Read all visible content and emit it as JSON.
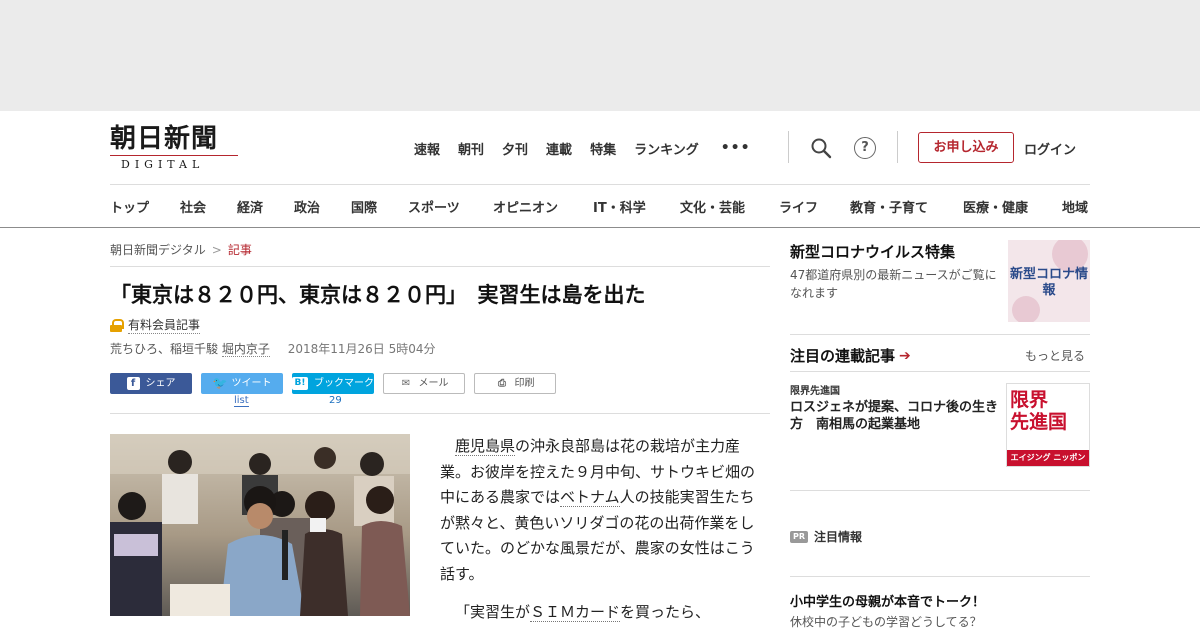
{
  "header": {
    "logo_main": "朝日新聞",
    "logo_sub": "DIGITAL",
    "top_nav": [
      "速報",
      "朝刊",
      "夕刊",
      "連載",
      "特集",
      "ランキング"
    ],
    "more_icon": "•••",
    "help_icon": "?",
    "subscribe": "お申し込み",
    "login": "ログイン",
    "accent_color": "#b5262e"
  },
  "category_nav": [
    "トップ",
    "社会",
    "経済",
    "政治",
    "国際",
    "スポーツ",
    "オピニオン",
    "IT・科学",
    "文化・芸能",
    "ライフ",
    "教育・子育て",
    "医療・健康",
    "地域"
  ],
  "breadcrumb": {
    "home": "朝日新聞デジタル",
    "sep": ">",
    "current": "記事"
  },
  "article": {
    "headline": "「東京は８２０円、東京は８２０円」　実習生は島を出た",
    "member_label": "有料会員記事",
    "authors": "荒ちひろ、稲垣千駿",
    "author_linked": "堀内京子",
    "date": "2018年11月26日 5時04分",
    "share": {
      "facebook": "シェア",
      "twitter": "ツイート",
      "twitter_count": "list",
      "hatena": "ブックマーク",
      "hatena_count": "29",
      "mail": "メール",
      "print": "印刷"
    },
    "para1_link1": "鹿児島県",
    "para1_a": "の沖永良部島は花の栽培が主力産業。お彼岸を控えた９月中旬、サトウキビ畑の中にある農家では",
    "para1_link2": "ベトナム",
    "para1_b": "人の技能実習生たちが黙々と、黄色いソリダゴの花の出荷作業をしていた。のどかな風景だが、農家の女性はこう話す。",
    "para2_a": "「実習生が",
    "para2_link": "ＳＩＭカード",
    "para2_b": "を買ったら、"
  },
  "sidebar": {
    "corona_title": "新型コロナウイルス特集",
    "corona_desc": "47都道府県別の最新ニュースがご覧になれます",
    "corona_badge": "新型コロナ情報",
    "rensai_title": "注目の連載記事",
    "rensai_more": "もっと見る",
    "series_label": "限界先進国",
    "series_headline": "ロスジェネが提案、コロナ後の生き方　南相馬の起業基地",
    "series_badge_line1": "限界",
    "series_badge_line2": "先進国",
    "series_badge_footer": "エイジング ニッポン",
    "pr_label": "PR",
    "pr_title": "注目情報",
    "promo_title": "小中学生の母親が本音でトーク！",
    "promo_sub": "休校中の子どもの学習どうしてる？"
  }
}
